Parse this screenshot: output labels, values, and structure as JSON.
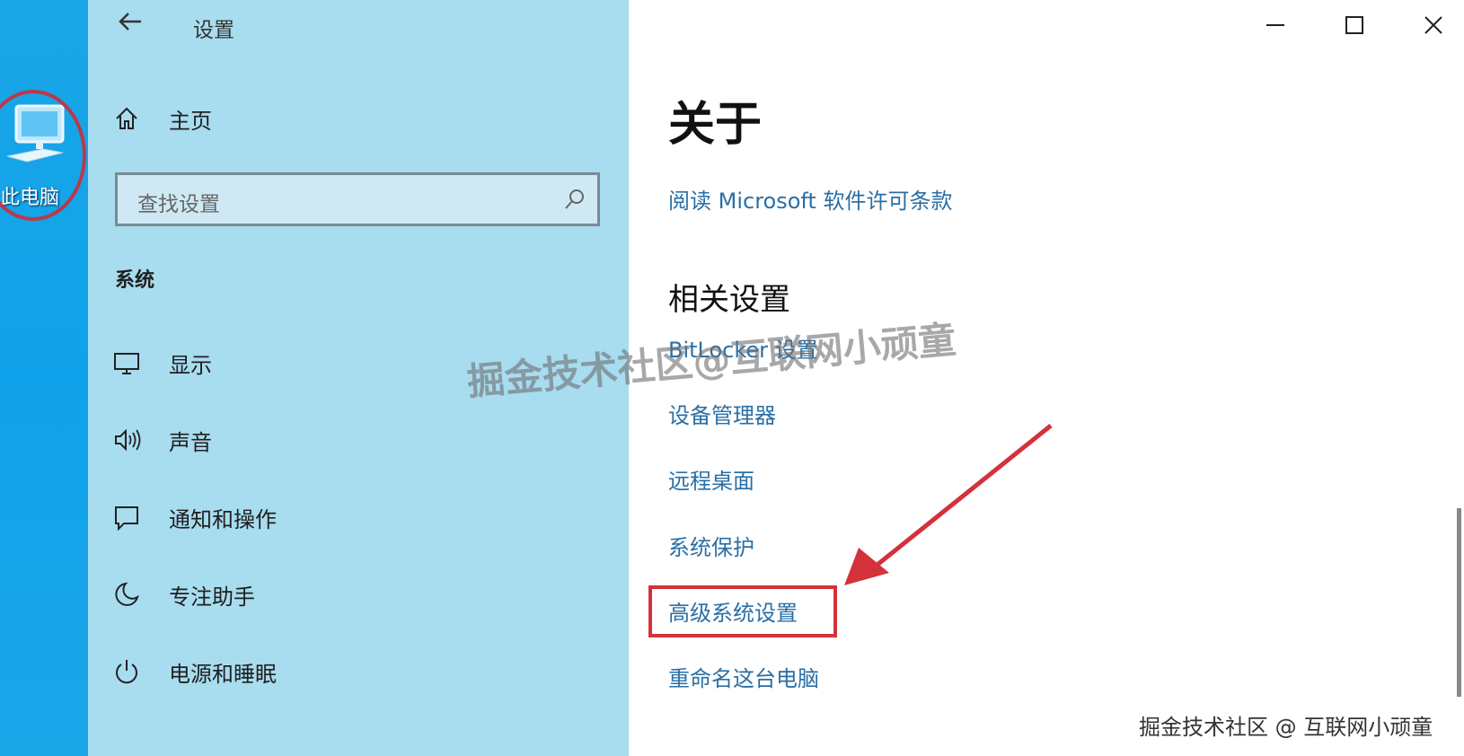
{
  "desktop": {
    "icon_label": "此电脑"
  },
  "window": {
    "title": "设置",
    "back_icon": "back-arrow-icon",
    "controls": {
      "minimize": "minimize-icon",
      "maximize": "maximize-icon",
      "close": "close-icon"
    }
  },
  "sidebar": {
    "home_label": "主页",
    "search_placeholder": "查找设置",
    "section_title": "系统",
    "items": [
      {
        "label": "显示",
        "icon": "monitor-icon"
      },
      {
        "label": "声音",
        "icon": "speaker-icon"
      },
      {
        "label": "通知和操作",
        "icon": "notification-icon"
      },
      {
        "label": "专注助手",
        "icon": "moon-icon"
      },
      {
        "label": "电源和睡眠",
        "icon": "power-icon"
      }
    ]
  },
  "main": {
    "title": "关于",
    "license_link": "阅读 Microsoft 软件许可条款",
    "related_title": "相关设置",
    "related_links": [
      "BitLocker 设置",
      "设备管理器",
      "远程桌面",
      "系统保护",
      "高级系统设置",
      "重命名这台电脑"
    ]
  },
  "annotations": {
    "highlight_color": "#d4323b",
    "watermark": "掘金技术社区@互联网小顽童",
    "corner_watermark": "掘金技术社区 @ 互联网小顽童"
  },
  "colors": {
    "sidebar_bg": "#a8dcef",
    "link": "#2a6fa5",
    "desktop": "#10a2ea"
  }
}
